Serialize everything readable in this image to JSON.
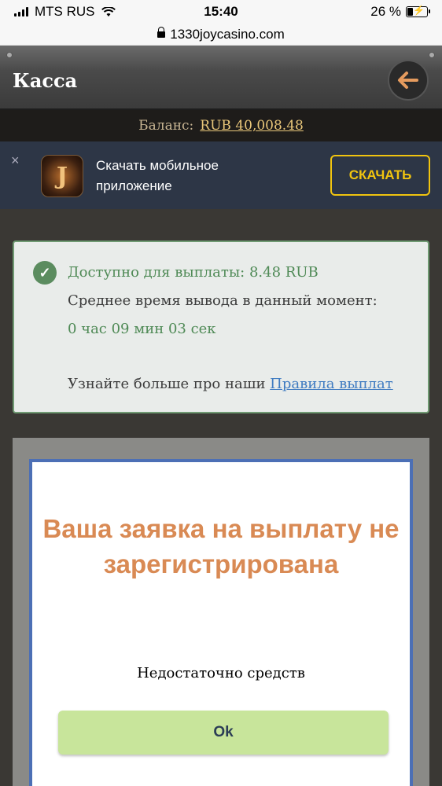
{
  "status_bar": {
    "carrier": "MTS RUS",
    "time": "15:40",
    "battery": "26 %",
    "battery_level": 0.26
  },
  "browser": {
    "url": "1330joycasino.com"
  },
  "header": {
    "title": "Касса"
  },
  "balance": {
    "label": "Баланс:",
    "value": "RUB 40,008.48"
  },
  "banner": {
    "close": "×",
    "app_letter": "J",
    "text": "Скачать мобильное приложение",
    "download_label": "СКАЧАТЬ"
  },
  "info": {
    "available": "Доступно для выплаты: 8.48 RUB",
    "avg_label": "Среднее время вывода в данный момент:",
    "avg_time": "0 час 09 мин 03 сек",
    "learn_prefix": "Узнайте больше про наши",
    "rules_link": "Правила выплат"
  },
  "modal": {
    "title": "Ваша заявка на выплату не зарегистрирована",
    "message": "Недостаточно средств",
    "ok_label": "Ok"
  },
  "colors": {
    "accent_yellow": "#f1c40f",
    "success_green": "#4f8a56",
    "modal_title": "#d98a54",
    "ok_button": "#c8e59b",
    "modal_border": "#4c6fb5"
  }
}
